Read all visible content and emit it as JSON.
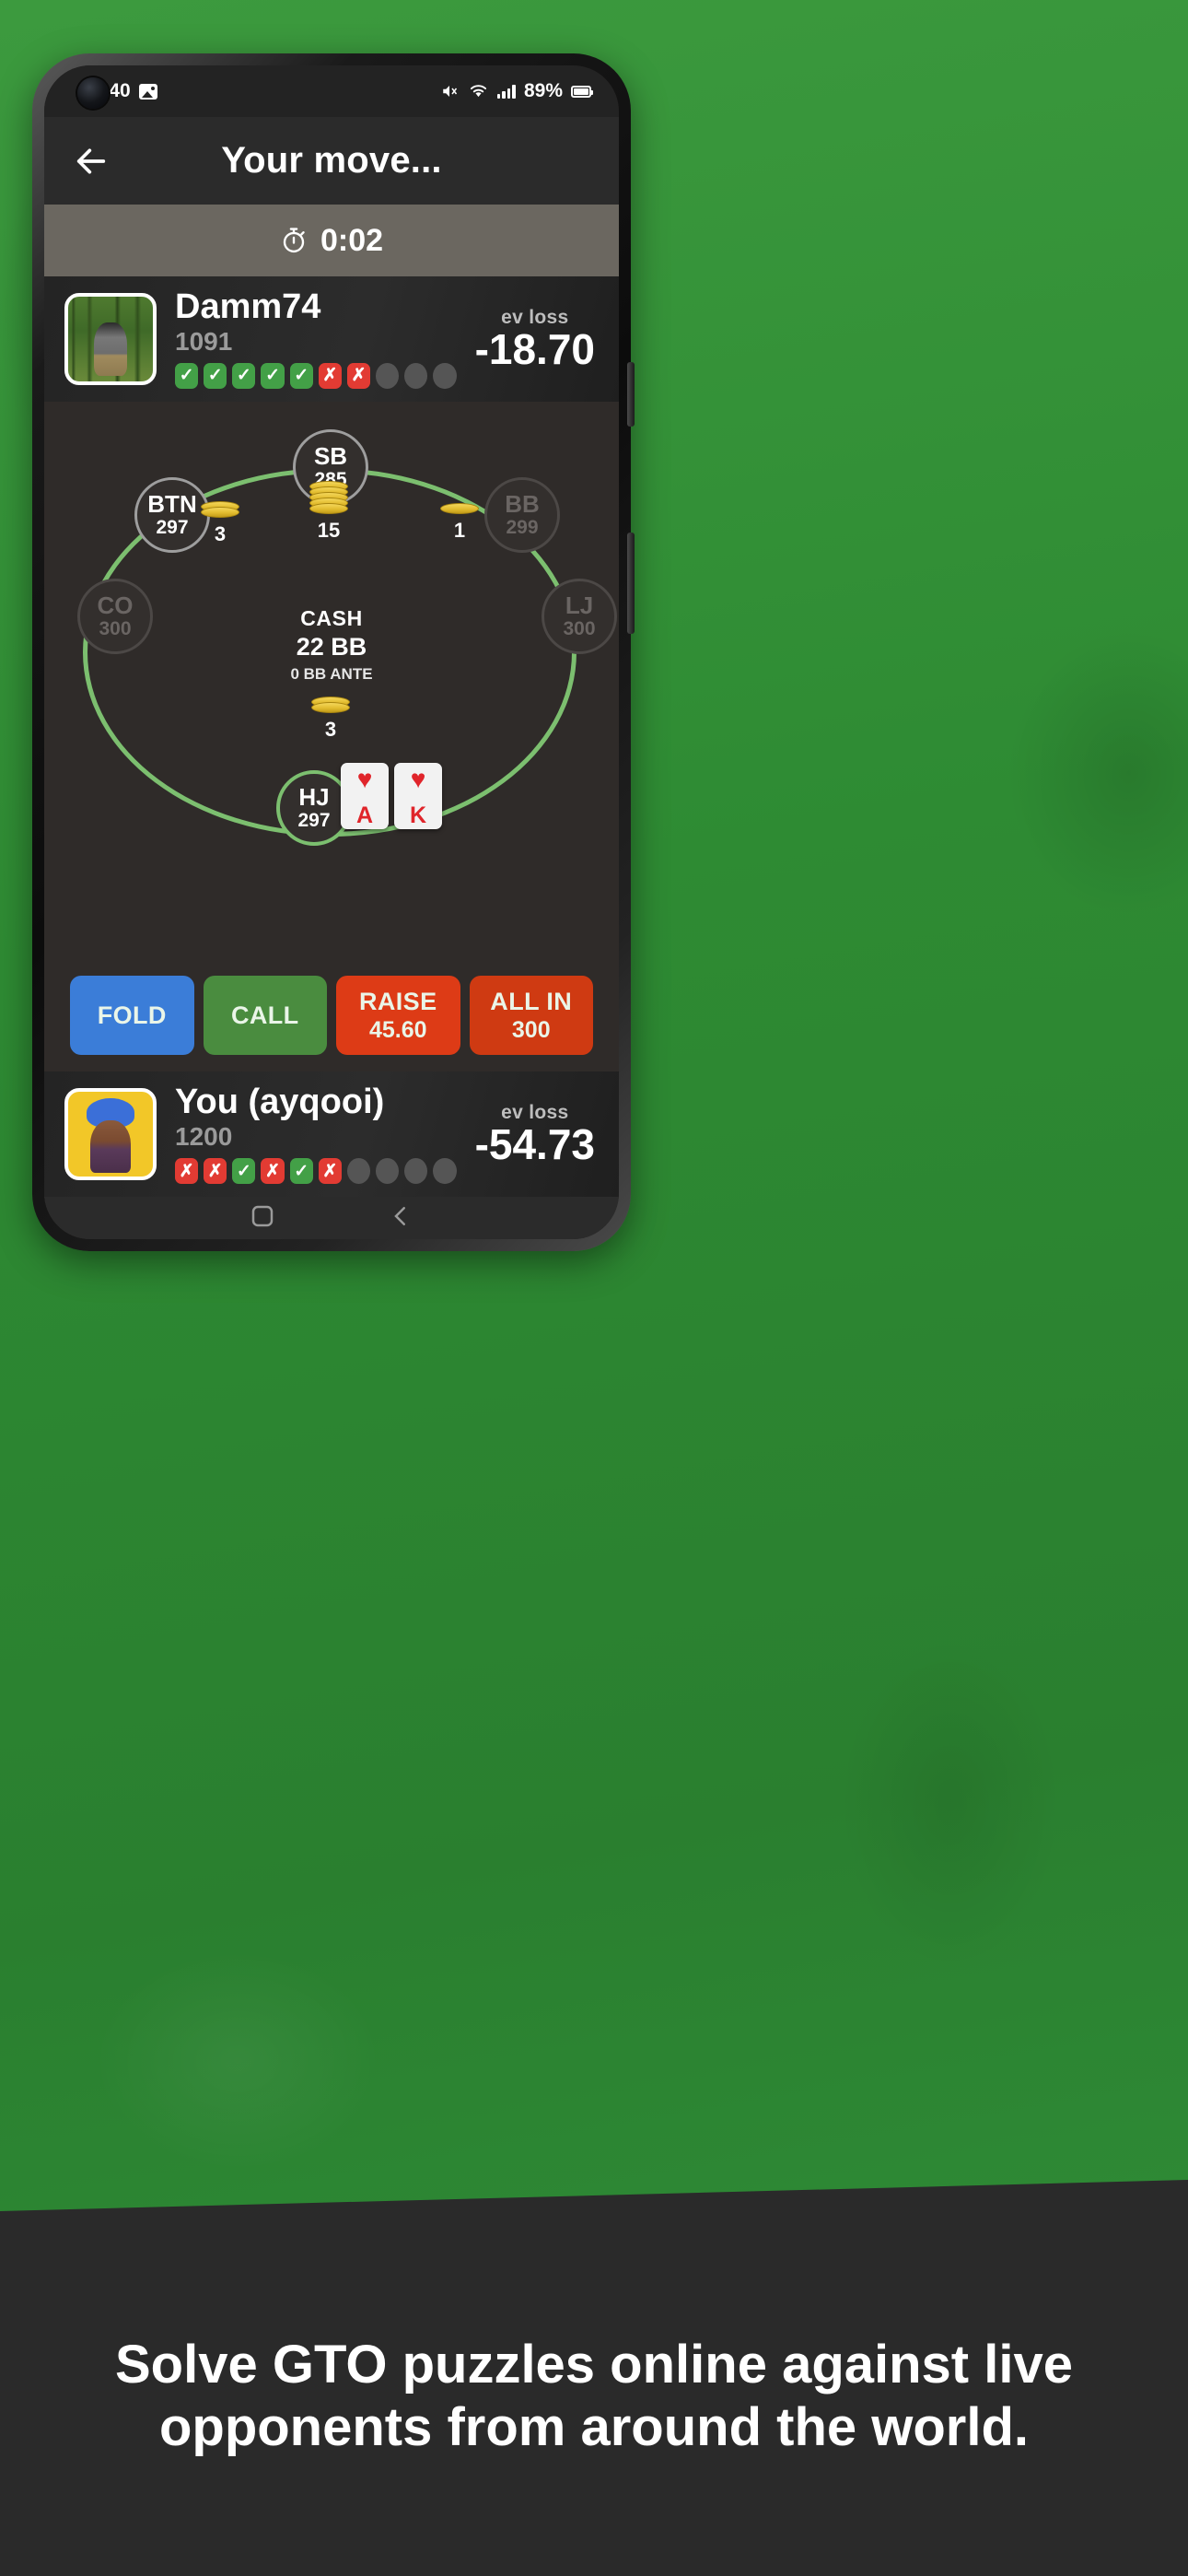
{
  "status_bar": {
    "time": "10:40",
    "battery_percent": "89%",
    "icons": [
      "image-icon",
      "mute-icon",
      "wifi-icon",
      "signal-icon",
      "battery-icon"
    ]
  },
  "app_bar": {
    "back_icon": "back-arrow-icon",
    "title": "Your move..."
  },
  "timer": {
    "icon": "stopwatch-icon",
    "value": "0:02"
  },
  "opponent": {
    "name": "Damm74",
    "stack": "1091",
    "ev_label": "ev loss",
    "ev_value": "-18.70",
    "avatar": "photo-avatar",
    "results": [
      "ok",
      "ok",
      "ok",
      "ok",
      "ok",
      "no",
      "no",
      "empty",
      "empty",
      "empty"
    ]
  },
  "hero": {
    "name": "You (ayqooi)",
    "stack": "1200",
    "ev_label": "ev loss",
    "ev_value": "-54.73",
    "avatar": "anime-avatar",
    "results": [
      "no",
      "no",
      "ok",
      "no",
      "ok",
      "no",
      "empty",
      "empty",
      "empty",
      "empty"
    ]
  },
  "table": {
    "game_type": "CASH",
    "blinds": "22 BB",
    "ante": "0 BB ANTE",
    "seats": [
      {
        "position": "SB",
        "stack": "285",
        "state": "active"
      },
      {
        "position": "BTN",
        "stack": "297",
        "state": "active"
      },
      {
        "position": "BB",
        "stack": "299",
        "state": "dim"
      },
      {
        "position": "CO",
        "stack": "300",
        "state": "dim"
      },
      {
        "position": "LJ",
        "stack": "300",
        "state": "dim"
      },
      {
        "position": "HJ",
        "stack": "297",
        "state": "hero"
      }
    ],
    "bets": [
      {
        "label": "btn-bet",
        "amount": "3",
        "stack_count": 2
      },
      {
        "label": "pot-bet",
        "amount": "15",
        "stack_count": 5
      },
      {
        "label": "bb-bet",
        "amount": "1",
        "stack_count": 1
      },
      {
        "label": "hero-bet",
        "amount": "3",
        "stack_count": 2
      }
    ],
    "hole_cards": [
      {
        "rank": "A",
        "suit": "♥",
        "color": "red"
      },
      {
        "rank": "K",
        "suit": "♥",
        "color": "red"
      }
    ]
  },
  "actions": [
    {
      "label": "FOLD",
      "sub": "",
      "color": "#3b7dd8"
    },
    {
      "label": "CALL",
      "sub": "",
      "color": "#4a8c3f"
    },
    {
      "label": "RAISE",
      "sub": "45.60",
      "color": "#dd3b16"
    },
    {
      "label": "ALL IN",
      "sub": "300",
      "color": "#cf3a12"
    }
  ],
  "banner": {
    "text": "Solve GTO puzzles online against live opponents from around the world."
  },
  "colors": {
    "background": "#2f8f35",
    "app_bg": "#2b2b2b",
    "table_bg": "#2f2b29",
    "felt_ring": "#7cbf6f",
    "timer_bg": "#6b6760",
    "ok": "#43a047",
    "no": "#e23b33"
  }
}
